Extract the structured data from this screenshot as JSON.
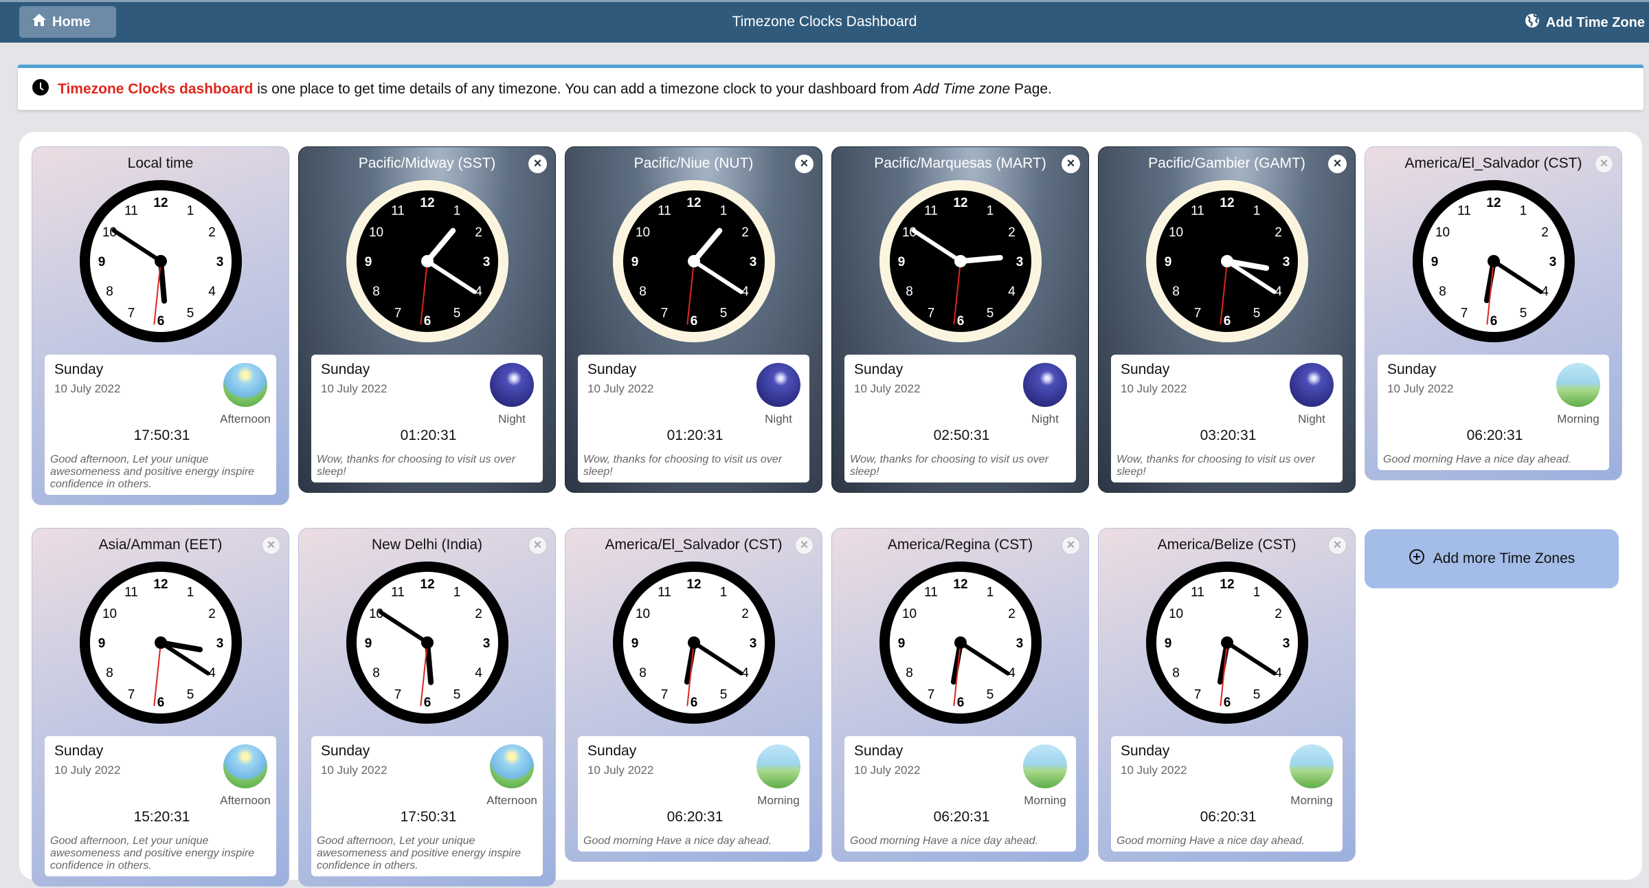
{
  "nav": {
    "home_label": "Home",
    "title": "Timezone Clocks Dashboard",
    "add_label": "Add Time Zone"
  },
  "info": {
    "highlight": "Timezone Clocks dashboard",
    "text1": "is one place to get time details of any timezone. You can add a timezone clock to your dashboard from",
    "link": "Add Time zone",
    "text2": "Page."
  },
  "add_more_label": "Add more Time Zones",
  "colors": {
    "nav": "#2f5a7c",
    "accent": "#e0261c",
    "info_border": "#52a0d6"
  },
  "cards": [
    {
      "title": "Local time",
      "theme": "light",
      "closable": false,
      "day": "Sunday",
      "date": "10 July 2022",
      "period": "Afternoon",
      "time": "17:50:31",
      "message": "Good afternoon, Let your unique awesomeness and positive energy inspire confidence in others."
    },
    {
      "title": "Pacific/Midway (SST)",
      "theme": "dark",
      "closable": true,
      "day": "Sunday",
      "date": "10 July 2022",
      "period": "Night",
      "time": "01:20:31",
      "message": "Wow, thanks for choosing to visit us over sleep!"
    },
    {
      "title": "Pacific/Niue (NUT)",
      "theme": "dark",
      "closable": true,
      "day": "Sunday",
      "date": "10 July 2022",
      "period": "Night",
      "time": "01:20:31",
      "message": "Wow, thanks for choosing to visit us over sleep!"
    },
    {
      "title": "Pacific/Marquesas (MART)",
      "theme": "dark",
      "closable": true,
      "day": "Sunday",
      "date": "10 July 2022",
      "period": "Night",
      "time": "02:50:31",
      "message": "Wow, thanks for choosing to visit us over sleep!"
    },
    {
      "title": "Pacific/Gambier (GAMT)",
      "theme": "dark",
      "closable": true,
      "day": "Sunday",
      "date": "10 July 2022",
      "period": "Night",
      "time": "03:20:31",
      "message": "Wow, thanks for choosing to visit us over sleep!"
    },
    {
      "title": "America/El_Salvador (CST)",
      "theme": "light",
      "closable": true,
      "day": "Sunday",
      "date": "10 July 2022",
      "period": "Morning",
      "time": "06:20:31",
      "message": "Good morning Have a nice day ahead."
    },
    {
      "title": "Asia/Amman (EET)",
      "theme": "light",
      "closable": true,
      "day": "Sunday",
      "date": "10 July 2022",
      "period": "Afternoon",
      "time": "15:20:31",
      "message": "Good afternoon, Let your unique awesomeness and positive energy inspire confidence in others."
    },
    {
      "title": "New Delhi (India)",
      "theme": "light",
      "closable": true,
      "day": "Sunday",
      "date": "10 July 2022",
      "period": "Afternoon",
      "time": "17:50:31",
      "message": "Good afternoon, Let your unique awesomeness and positive energy inspire confidence in others."
    },
    {
      "title": "America/El_Salvador (CST)",
      "theme": "light",
      "closable": true,
      "day": "Sunday",
      "date": "10 July 2022",
      "period": "Morning",
      "time": "06:20:31",
      "message": "Good morning Have a nice day ahead."
    },
    {
      "title": "America/Regina (CST)",
      "theme": "light",
      "closable": true,
      "day": "Sunday",
      "date": "10 July 2022",
      "period": "Morning",
      "time": "06:20:31",
      "message": "Good morning Have a nice day ahead."
    },
    {
      "title": "America/Belize (CST)",
      "theme": "light",
      "closable": true,
      "day": "Sunday",
      "date": "10 July 2022",
      "period": "Morning",
      "time": "06:20:31",
      "message": "Good morning Have a nice day ahead."
    }
  ]
}
